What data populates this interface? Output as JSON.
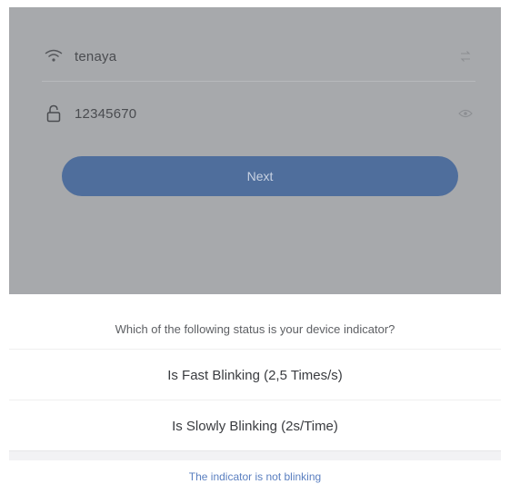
{
  "form": {
    "wifi_name": "tenaya",
    "password": "12345670",
    "next_label": "Next"
  },
  "sheet": {
    "question": "Which of the following status is your device indicator?",
    "options": [
      "Is Fast Blinking  (2,5 Times/s)",
      "Is Slowly Blinking  (2s/Time)"
    ],
    "link": "The indicator is not blinking"
  },
  "colors": {
    "backdrop": "#a7a9ac",
    "button": "#4f6e9c",
    "link": "#5a7fc0"
  },
  "icons": {
    "wifi": "wifi-icon",
    "lock": "lock-icon",
    "swap": "swap-icon",
    "eye": "eye-icon"
  }
}
